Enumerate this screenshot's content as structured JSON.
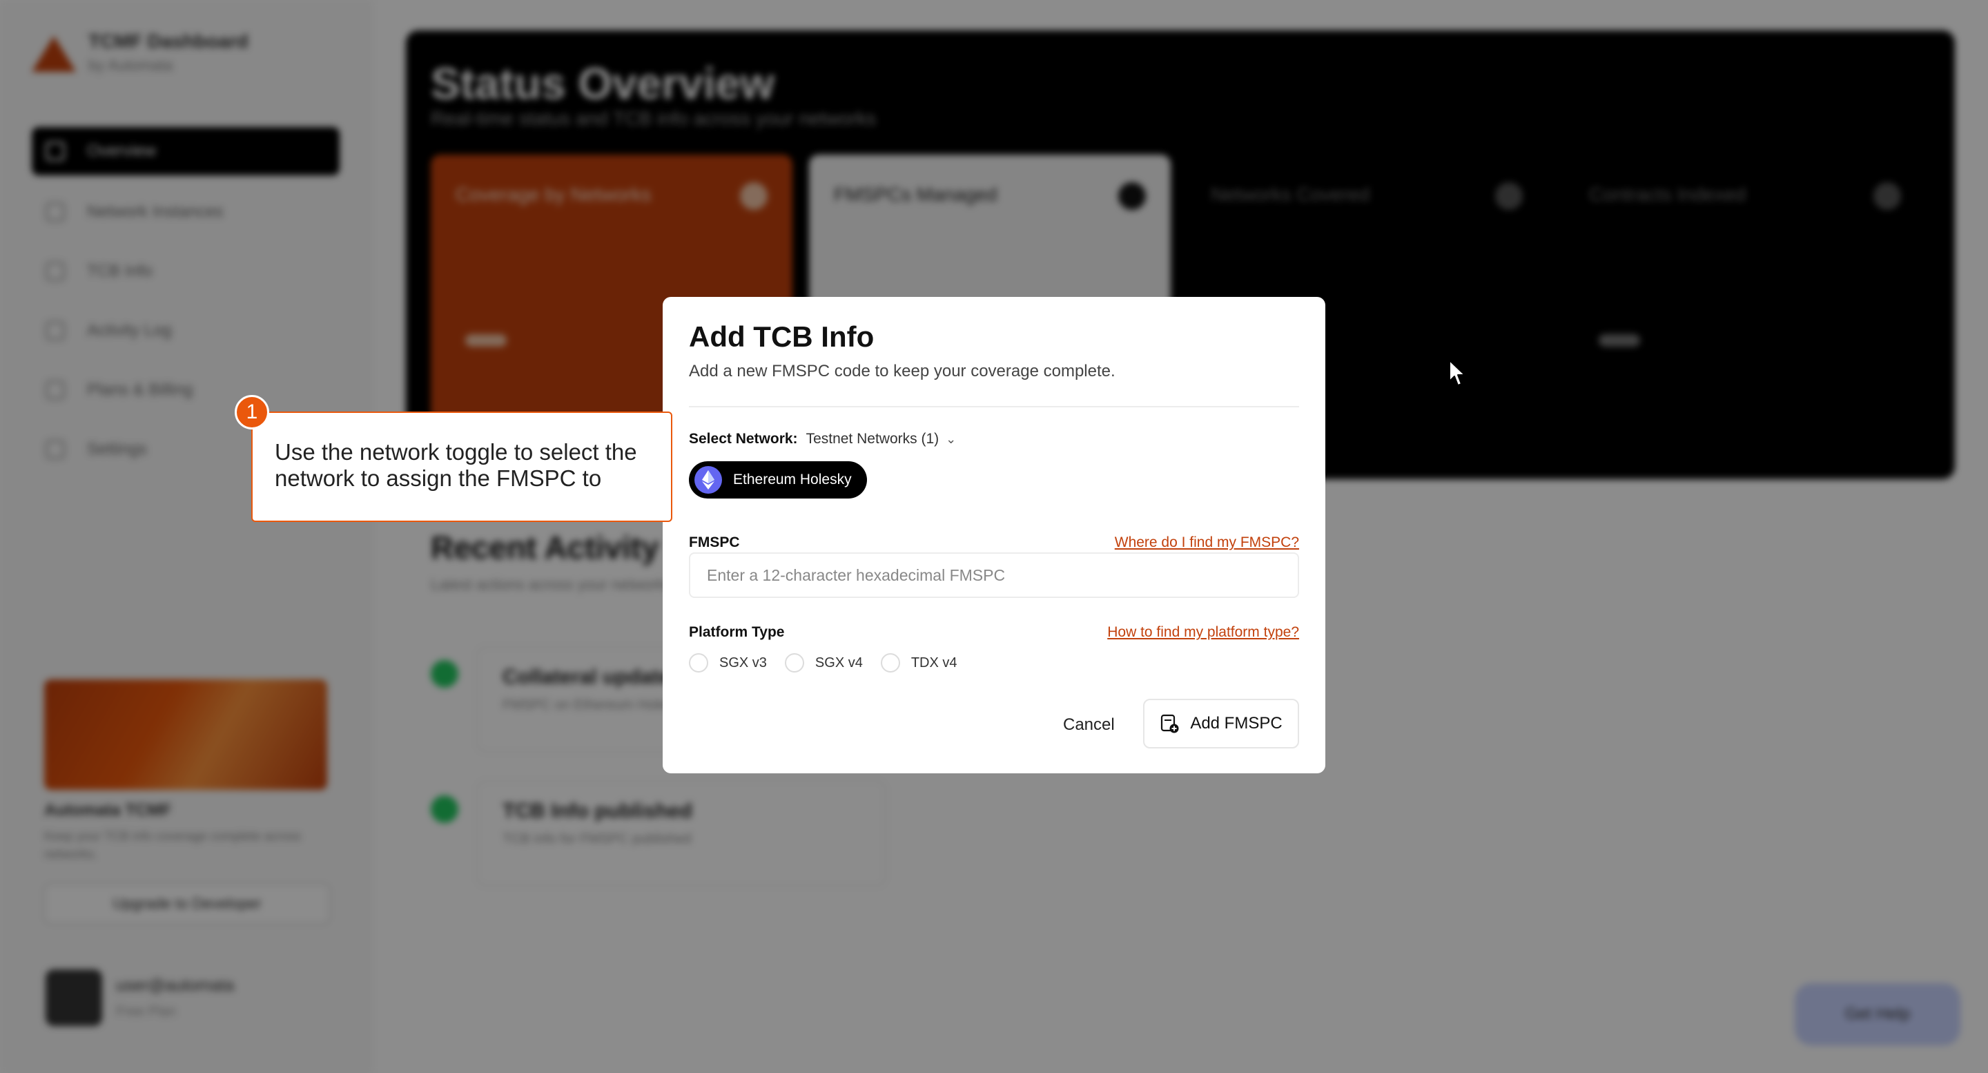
{
  "background": {
    "brand": {
      "title": "TCMF Dashboard",
      "subtitle": "by Automata"
    },
    "nav": [
      "Overview",
      "Network Instances",
      "TCB Info",
      "Activity Log",
      "Plans & Billing",
      "Settings"
    ],
    "hero": {
      "title": "Status Overview",
      "subtitle": "Real-time status and TCB info across your networks",
      "cards": [
        "Coverage by Networks",
        "FMSPCs Managed",
        "Networks Covered",
        "Contracts Indexed"
      ]
    },
    "activity": {
      "title": "Recent Activity",
      "subtitle": "Latest actions across your networks",
      "items": [
        {
          "title": "Collateral updated",
          "text": "FMSPC on Ethereum Holesky"
        },
        {
          "title": "TCB Info published",
          "text": "TCB info for FMSPC published"
        }
      ]
    },
    "promo": {
      "title": "Automata TCMF",
      "text": "Keep your TCB info coverage complete across networks.",
      "button": "Upgrade to Developer"
    },
    "user": {
      "name": "user@automata",
      "sub": "Free Plan"
    },
    "help": "Get Help"
  },
  "modal": {
    "title": "Add TCB Info",
    "description": "Add a new FMSPC code to keep your coverage complete.",
    "network_label": "Select Network:",
    "network_value": "Testnet Networks (1)",
    "selected_network": "Ethereum Holesky",
    "fmspc_label": "FMSPC",
    "fmspc_help": "Where do I find my FMSPC?",
    "fmspc_placeholder": "Enter a 12-character hexadecimal FMSPC",
    "fmspc_value": "",
    "platform_label": "Platform Type",
    "platform_help": "How to find my platform type?",
    "platform_options": [
      "SGX v3",
      "SGX v4",
      "TDX v4"
    ],
    "cancel_label": "Cancel",
    "submit_label": "Add FMSPC"
  },
  "tour": {
    "step": "1",
    "text": "Use the network toggle to select the network to assign the FMSPC to"
  },
  "colors": {
    "accent": "#ea580c",
    "link": "#c2410c",
    "pill_bg": "#000000",
    "eth": "#6366f1"
  },
  "icons": {
    "network_chevron": "chevron-down-icon",
    "network": "ethereum-icon",
    "submit": "file-add-icon"
  }
}
